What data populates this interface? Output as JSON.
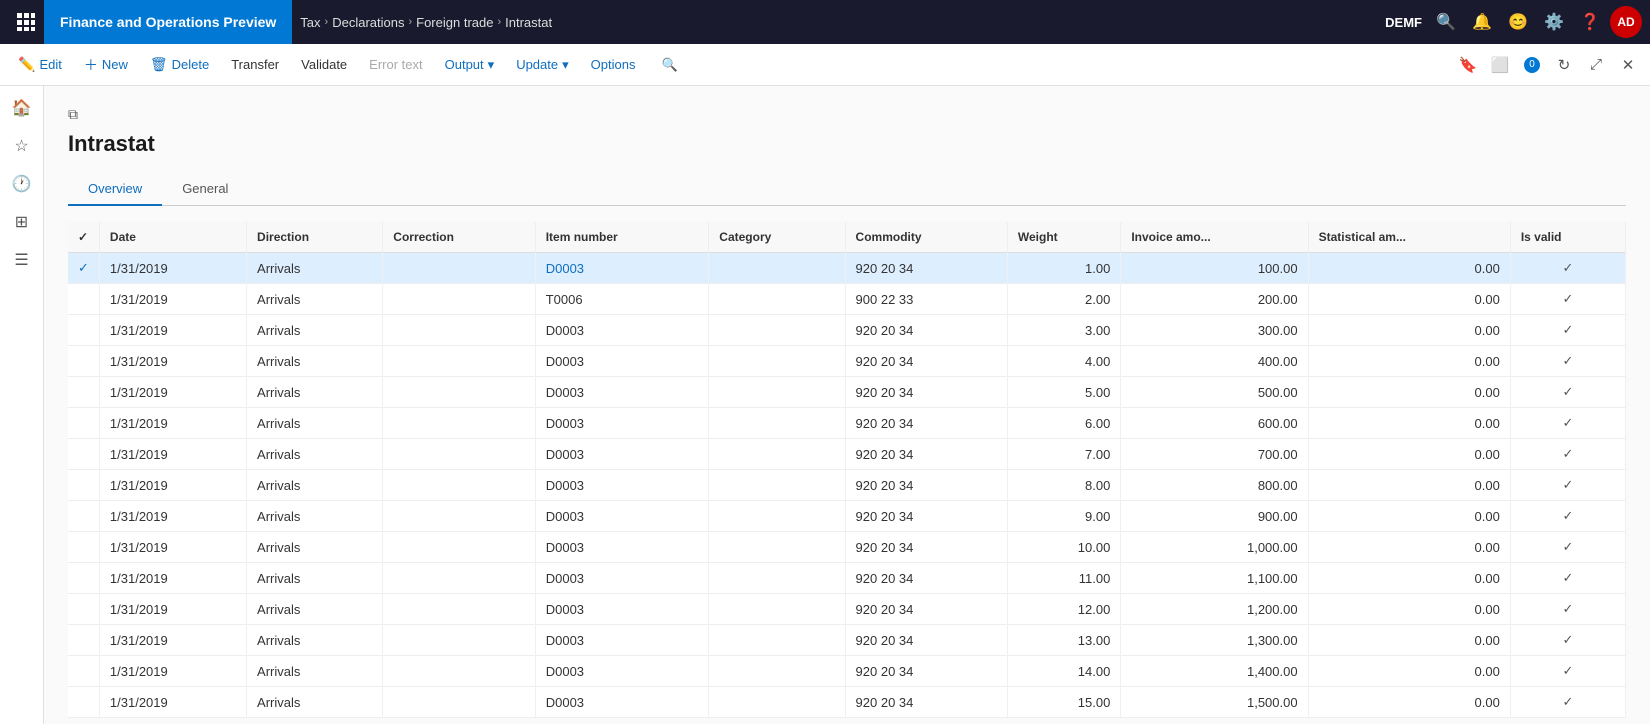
{
  "topBar": {
    "appTitle": "Finance and Operations Preview",
    "breadcrumbs": [
      "Tax",
      "Declarations",
      "Foreign trade",
      "Intrastat"
    ],
    "userCode": "DEMF",
    "avatarText": "AD"
  },
  "actionBar": {
    "editLabel": "Edit",
    "newLabel": "New",
    "deleteLabel": "Delete",
    "transferLabel": "Transfer",
    "validateLabel": "Validate",
    "errorTextLabel": "Error text",
    "outputLabel": "Output",
    "updateLabel": "Update",
    "optionsLabel": "Options"
  },
  "pageTitle": "Intrastat",
  "tabs": [
    {
      "label": "Overview",
      "active": true
    },
    {
      "label": "General",
      "active": false
    }
  ],
  "tableColumns": [
    "",
    "Date",
    "Direction",
    "Correction",
    "Item number",
    "Category",
    "Commodity",
    "Weight",
    "Invoice amo...",
    "Statistical am...",
    "Is valid"
  ],
  "tableRows": [
    {
      "selected": true,
      "date": "1/31/2019",
      "direction": "Arrivals",
      "correction": "",
      "itemNumber": "D0003",
      "category": "",
      "commodity": "920 20 34",
      "weight": "1.00",
      "invoiceAmt": "100.00",
      "statAmt": "0.00",
      "isValid": true
    },
    {
      "selected": false,
      "date": "1/31/2019",
      "direction": "Arrivals",
      "correction": "",
      "itemNumber": "T0006",
      "category": "",
      "commodity": "900 22 33",
      "weight": "2.00",
      "invoiceAmt": "200.00",
      "statAmt": "0.00",
      "isValid": true
    },
    {
      "selected": false,
      "date": "1/31/2019",
      "direction": "Arrivals",
      "correction": "",
      "itemNumber": "D0003",
      "category": "",
      "commodity": "920 20 34",
      "weight": "3.00",
      "invoiceAmt": "300.00",
      "statAmt": "0.00",
      "isValid": true
    },
    {
      "selected": false,
      "date": "1/31/2019",
      "direction": "Arrivals",
      "correction": "",
      "itemNumber": "D0003",
      "category": "",
      "commodity": "920 20 34",
      "weight": "4.00",
      "invoiceAmt": "400.00",
      "statAmt": "0.00",
      "isValid": true
    },
    {
      "selected": false,
      "date": "1/31/2019",
      "direction": "Arrivals",
      "correction": "",
      "itemNumber": "D0003",
      "category": "",
      "commodity": "920 20 34",
      "weight": "5.00",
      "invoiceAmt": "500.00",
      "statAmt": "0.00",
      "isValid": true
    },
    {
      "selected": false,
      "date": "1/31/2019",
      "direction": "Arrivals",
      "correction": "",
      "itemNumber": "D0003",
      "category": "",
      "commodity": "920 20 34",
      "weight": "6.00",
      "invoiceAmt": "600.00",
      "statAmt": "0.00",
      "isValid": true
    },
    {
      "selected": false,
      "date": "1/31/2019",
      "direction": "Arrivals",
      "correction": "",
      "itemNumber": "D0003",
      "category": "",
      "commodity": "920 20 34",
      "weight": "7.00",
      "invoiceAmt": "700.00",
      "statAmt": "0.00",
      "isValid": true
    },
    {
      "selected": false,
      "date": "1/31/2019",
      "direction": "Arrivals",
      "correction": "",
      "itemNumber": "D0003",
      "category": "",
      "commodity": "920 20 34",
      "weight": "8.00",
      "invoiceAmt": "800.00",
      "statAmt": "0.00",
      "isValid": true
    },
    {
      "selected": false,
      "date": "1/31/2019",
      "direction": "Arrivals",
      "correction": "",
      "itemNumber": "D0003",
      "category": "",
      "commodity": "920 20 34",
      "weight": "9.00",
      "invoiceAmt": "900.00",
      "statAmt": "0.00",
      "isValid": true
    },
    {
      "selected": false,
      "date": "1/31/2019",
      "direction": "Arrivals",
      "correction": "",
      "itemNumber": "D0003",
      "category": "",
      "commodity": "920 20 34",
      "weight": "10.00",
      "invoiceAmt": "1,000.00",
      "statAmt": "0.00",
      "isValid": true
    },
    {
      "selected": false,
      "date": "1/31/2019",
      "direction": "Arrivals",
      "correction": "",
      "itemNumber": "D0003",
      "category": "",
      "commodity": "920 20 34",
      "weight": "11.00",
      "invoiceAmt": "1,100.00",
      "statAmt": "0.00",
      "isValid": true
    },
    {
      "selected": false,
      "date": "1/31/2019",
      "direction": "Arrivals",
      "correction": "",
      "itemNumber": "D0003",
      "category": "",
      "commodity": "920 20 34",
      "weight": "12.00",
      "invoiceAmt": "1,200.00",
      "statAmt": "0.00",
      "isValid": true
    },
    {
      "selected": false,
      "date": "1/31/2019",
      "direction": "Arrivals",
      "correction": "",
      "itemNumber": "D0003",
      "category": "",
      "commodity": "920 20 34",
      "weight": "13.00",
      "invoiceAmt": "1,300.00",
      "statAmt": "0.00",
      "isValid": true
    },
    {
      "selected": false,
      "date": "1/31/2019",
      "direction": "Arrivals",
      "correction": "",
      "itemNumber": "D0003",
      "category": "",
      "commodity": "920 20 34",
      "weight": "14.00",
      "invoiceAmt": "1,400.00",
      "statAmt": "0.00",
      "isValid": true
    },
    {
      "selected": false,
      "date": "1/31/2019",
      "direction": "Arrivals",
      "correction": "",
      "itemNumber": "D0003",
      "category": "",
      "commodity": "920 20 34",
      "weight": "15.00",
      "invoiceAmt": "1,500.00",
      "statAmt": "0.00",
      "isValid": true
    }
  ]
}
